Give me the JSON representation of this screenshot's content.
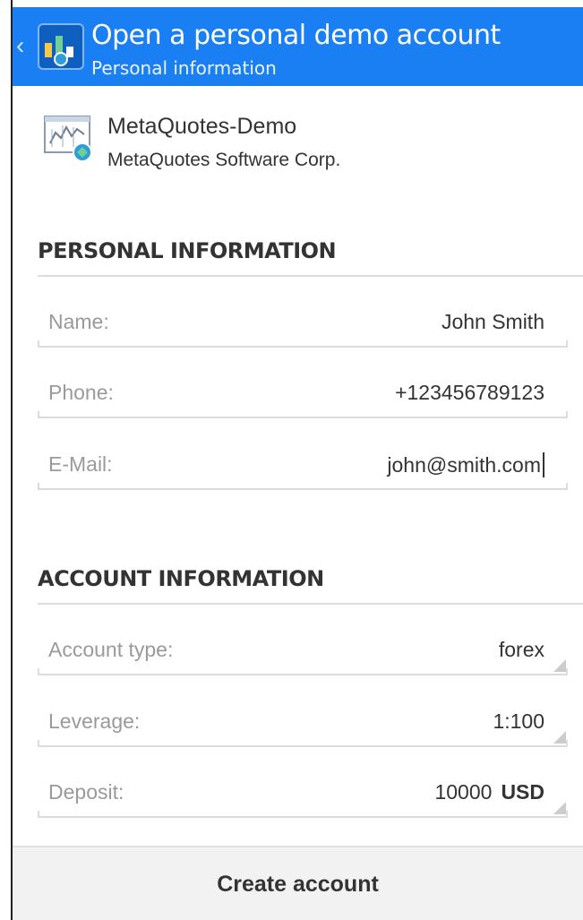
{
  "header": {
    "title": "Open a personal demo account",
    "subtitle": "Personal information",
    "back_glyph": "‹"
  },
  "server": {
    "name": "MetaQuotes-Demo",
    "company": "MetaQuotes Software Corp."
  },
  "personal_section": {
    "title": "PERSONAL INFORMATION",
    "fields": [
      {
        "label": "Name:",
        "value": "John Smith"
      },
      {
        "label": "Phone:",
        "value": "+123456789123"
      },
      {
        "label": "E-Mail:",
        "value": "john@smith.com"
      }
    ]
  },
  "account_section": {
    "title": "ACCOUNT INFORMATION",
    "fields": [
      {
        "label": "Account type:",
        "value": "forex"
      },
      {
        "label": "Leverage:",
        "value": "1:100"
      },
      {
        "label": "Deposit:",
        "value": "10000",
        "currency": "USD"
      }
    ]
  },
  "footer": {
    "create_label": "Create account"
  },
  "colors": {
    "actionbar": "#1a7ff2",
    "label_gray": "#9a9a9a",
    "text_dark": "#333333"
  },
  "icons": {
    "back": "chevron-left-icon",
    "app": "metatrader-app-icon",
    "server": "server-chart-icon",
    "spinner": "dropdown-corner-icon"
  }
}
